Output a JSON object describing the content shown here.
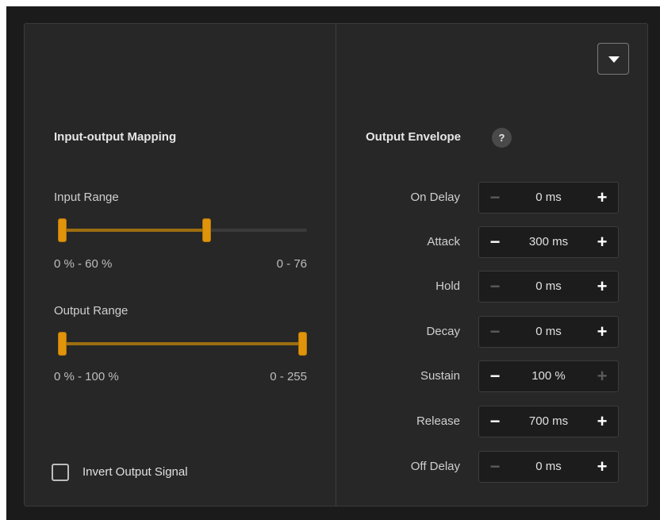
{
  "left": {
    "heading": "Input-output Mapping",
    "input_range": {
      "label": "Input Range",
      "percent_text": "0 % - 60 %",
      "value_text": "0 - 76",
      "low": 0,
      "high": 60
    },
    "output_range": {
      "label": "Output Range",
      "percent_text": "0 % - 100 %",
      "value_text": "0 - 255",
      "low": 0,
      "high": 100
    },
    "invert": {
      "label": "Invert Output Signal",
      "checked": false
    }
  },
  "right": {
    "heading": "Output Envelope",
    "help_glyph": "?",
    "dropdown_icon": "caret-down-icon",
    "rows": [
      {
        "label": "On Delay",
        "value": "0 ms",
        "minus_enabled": false,
        "plus_enabled": true
      },
      {
        "label": "Attack",
        "value": "300 ms",
        "minus_enabled": true,
        "plus_enabled": true
      },
      {
        "label": "Hold",
        "value": "0 ms",
        "minus_enabled": false,
        "plus_enabled": true
      },
      {
        "label": "Decay",
        "value": "0 ms",
        "minus_enabled": false,
        "plus_enabled": true
      },
      {
        "label": "Sustain",
        "value": "100 %",
        "minus_enabled": true,
        "plus_enabled": false
      },
      {
        "label": "Release",
        "value": "700 ms",
        "minus_enabled": true,
        "plus_enabled": true
      },
      {
        "label": "Off Delay",
        "value": "0 ms",
        "minus_enabled": false,
        "plus_enabled": true
      }
    ],
    "minus_glyph": "−",
    "plus_glyph": "+"
  },
  "colors": {
    "accent": "#e0940b",
    "accent_fill": "#9c6e10",
    "panel": "#272727",
    "background": "#1b1b1b"
  }
}
